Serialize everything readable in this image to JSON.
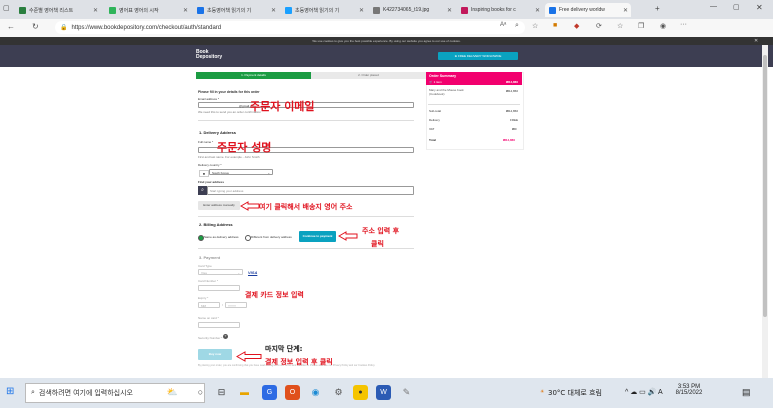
{
  "browser": {
    "tabs": [
      {
        "label": "수준별 영어책 리스트",
        "color": "#2a7f3f"
      },
      {
        "label": "영어표 영어의 시작",
        "color": "#2fb45a"
      },
      {
        "label": "초등영어책 읽기의 기",
        "color": "#1a73e8"
      },
      {
        "label": "초등영어책 읽기의 기",
        "color": "#1aa0ff"
      },
      {
        "label": "K422734065_t19.jpg",
        "color": "#777777"
      },
      {
        "label": "Inspiring books for c",
        "color": "#c2185b"
      },
      {
        "label": "Free delivery worldw",
        "color": "#1a73e8"
      }
    ],
    "url": "https://www.bookdepository.com/checkout/auth/standard",
    "url_host": "www.bookdepository.com"
  },
  "site": {
    "cookie_notice": "We use cookies to give you the best possible experience. By using our website you agree to our use of cookies.",
    "logo_line1": "Book",
    "logo_line2": "Depository",
    "free_delivery": "FREE DELIVERY WORLDWIDE"
  },
  "steps": {
    "step1": "1. Payment details",
    "step2": "2. Order placed"
  },
  "form": {
    "intro": "Please fill in your details for this order",
    "email_label": "Email address *",
    "email_value": "@gmail.com",
    "email_hint": "We need this to send you an order confirmation",
    "delivery_title": "1. Delivery Address",
    "fullname_label": "Full name *",
    "fullname_hint": "First and last name. For example - John Smith",
    "country_label": "Delivery country *",
    "country_value": "South Korea",
    "find_label": "Find your address",
    "find_placeholder": "Start typing your address",
    "manual_button": "Enter address manually",
    "billing_title": "2. Billing Address",
    "billing_same": "Same as delivery address",
    "billing_diff": "Different from delivery address",
    "continue_button": "Continue to payment",
    "payment_title": "3. Payment",
    "card_type_label": "Card Type",
    "card_type_value": "Visa",
    "visa_badge": "VISA",
    "card_number_label": "Card Number *",
    "expiry_label": "Expiry *",
    "expiry_mm": "MM",
    "expiry_yyyy": "YYYY",
    "name_on_card_label": "Name on card *",
    "security_label": "Security Number *",
    "buy_button": "Buy now",
    "legal": "By placing your order, you are confirming that you have read and agree to our Terms and Conditions. Please also see our Privacy Policy and our Cookies Policy."
  },
  "summary": {
    "title": "Order Summary",
    "items": "1 item",
    "total_head": "₩14,860",
    "book_title": "Mary and the Mouse book (Cookbook)",
    "book_price": "₩14,860",
    "subtotal_label": "Sub-total",
    "subtotal": "₩14,860",
    "delivery_label": "Delivery",
    "delivery": "FREE",
    "vat_label": "VAT",
    "vat": "₩0",
    "total_label": "Total",
    "total": "₩14,860"
  },
  "annotations": {
    "email": "주문자 이메일",
    "name": "주문자 성명",
    "manual": "여기 클릭해서 배송지 영어 주소",
    "continue_1": "주소 입력 후",
    "continue_2": "클릭",
    "card": "결제 카드 정보 입력",
    "final_1": "마지막 단계:",
    "final_2": "결제 정보 입력 후 클릭"
  },
  "taskbar": {
    "search_placeholder": "검색하려면 여기에 입력하십시오",
    "weather": "30°C 대체로 흐림",
    "time": "3:53 PM",
    "date": "8/15/2022"
  },
  "colors": {
    "brand_dark": "#3d3e52",
    "accent_pink": "#f2006e",
    "accent_teal": "#0aa2c0",
    "green": "#1b9c43",
    "annotation_red": "#e0111d"
  }
}
